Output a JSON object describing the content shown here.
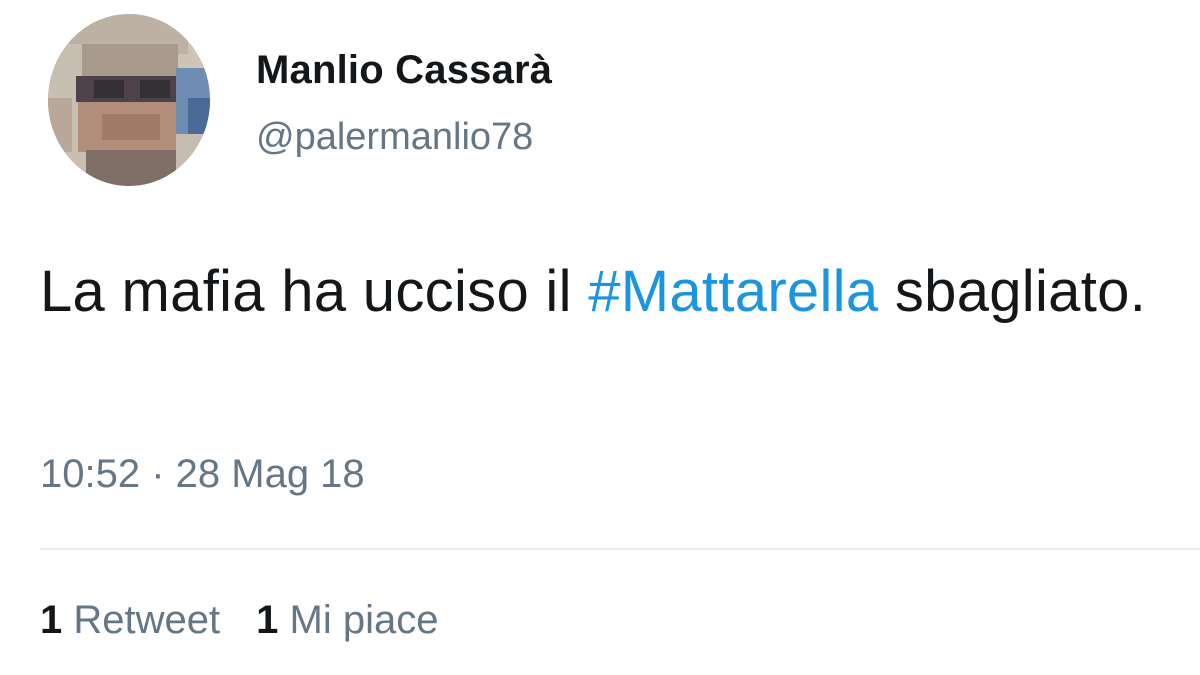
{
  "tweet": {
    "author": {
      "display_name": "Manlio Cassarà",
      "handle": "@palermanlio78",
      "avatar_icon": "pixelated-profile-photo"
    },
    "text_before_hashtag": "La mafia ha ucciso il ",
    "hashtag": "#Mattarella",
    "text_after_hashtag": " sbagliato.",
    "timestamp": "10:52 · 28 Mag 18",
    "stats": {
      "retweets_count": "1",
      "retweets_label": "Retweet",
      "likes_count": "1",
      "likes_label": "Mi piace"
    }
  },
  "colors": {
    "text": "#14171a",
    "secondary_text": "#657786",
    "hashtag": "#1b95e0",
    "divider": "#e6ecf0",
    "background": "#ffffff"
  }
}
